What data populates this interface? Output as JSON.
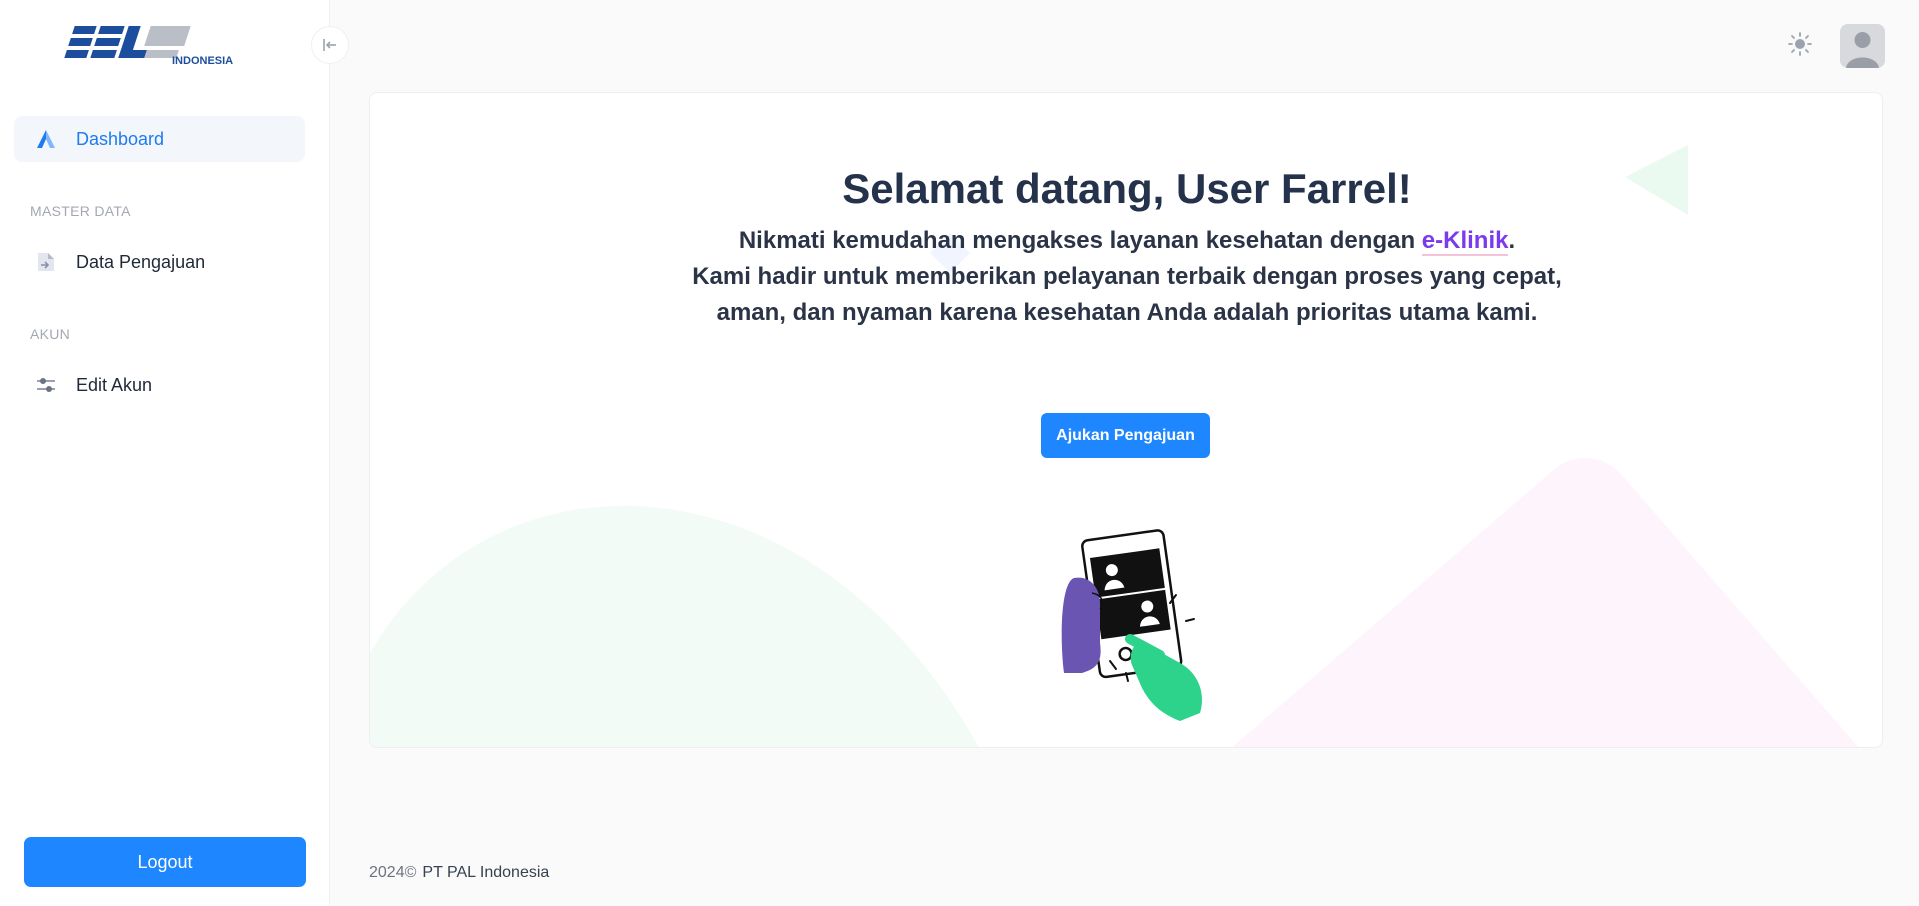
{
  "logo": {
    "name": "PAL",
    "subtitle": "INDONESIA"
  },
  "sidebar": {
    "items": [
      {
        "label": "Dashboard",
        "icon": "dashboard-icon",
        "active": true
      },
      {
        "label": "Data Pengajuan",
        "icon": "document-icon",
        "active": false
      },
      {
        "label": "Edit Akun",
        "icon": "sliders-icon",
        "active": false
      }
    ],
    "sections": {
      "master": "MASTER DATA",
      "akun": "AKUN"
    },
    "logout_label": "Logout",
    "collapse_icon": "collapse-left-icon"
  },
  "header": {
    "theme_icon": "sun-icon",
    "avatar_icon": "user-avatar-icon"
  },
  "main": {
    "welcome_title": "Selamat datang, User Farrel!",
    "line1_prefix": "Nikmati kemudahan mengakses layanan kesehatan dengan ",
    "brand": "e-Klinik",
    "line1_suffix": ".",
    "line2": "Kami hadir untuk memberikan pelayanan terbaik dengan proses yang cepat,",
    "line3": "aman, dan nyaman karena kesehatan Anda adalah prioritas utama kami.",
    "cta_label": "Ajukan Pengajuan",
    "illustration": "phone-video-call-illustration"
  },
  "footer": {
    "year": "2024©",
    "company": "PT PAL Indonesia"
  },
  "colors": {
    "primary": "#1e86ff",
    "brand_text": "#7c3aed",
    "active_nav": "#1e7bf0",
    "illustration_green": "#2dd38a",
    "illustration_purple": "#6b55b3"
  }
}
